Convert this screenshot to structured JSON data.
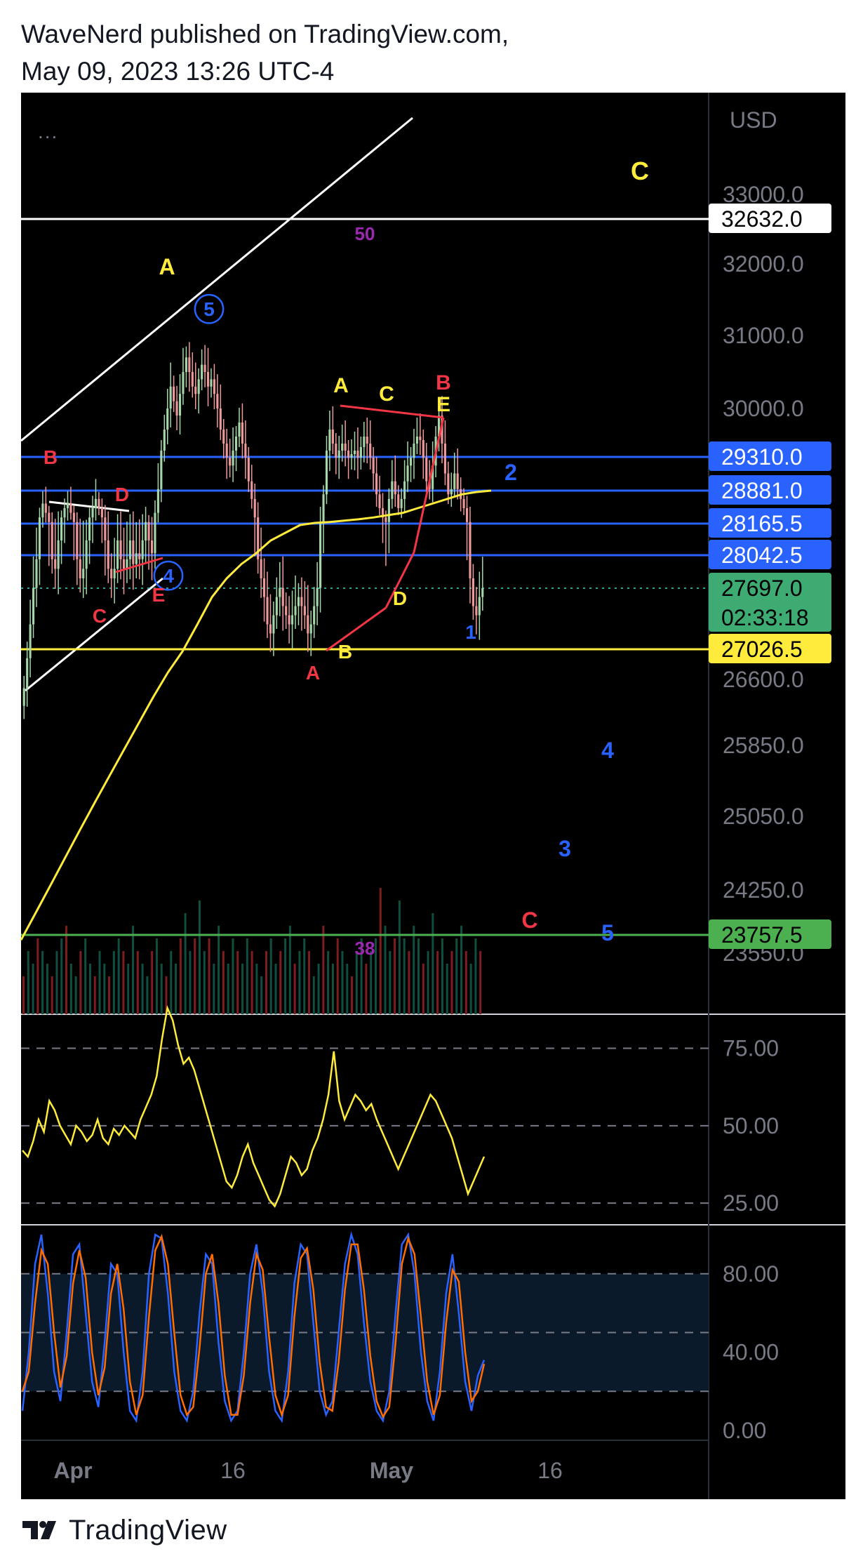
{
  "header": {
    "line1": "WaveNerd published on TradingView.com,",
    "line2": "May 09, 2023 13:26 UTC-4"
  },
  "footer": {
    "brand": "TradingView",
    "logo_icon": "tradingview-logo-icon"
  },
  "more_menu": "...",
  "colors": {
    "background": "#000000",
    "axis_text": "#787b86",
    "blue": "#2962ff",
    "yellow": "#ffeb3b",
    "red": "#f23645",
    "green": "#4caf50",
    "white": "#ffffff",
    "purple": "#9c27b0",
    "orange": "#ff6d00"
  },
  "chart_data": [
    {
      "type": "candlestick",
      "title": "",
      "currency": "USD",
      "x_ticks": [
        "Apr",
        "16",
        "May",
        "16"
      ],
      "y_ticks": [
        33000.0,
        32000.0,
        31000.0,
        30000.0,
        26600.0,
        25850.0,
        25050.0,
        24250.0,
        23550.0
      ],
      "y_tick_labels": [
        "33000.0",
        "32000.0",
        "31000.0",
        "30000.0",
        "26600.0",
        "25850.0",
        "25050.0",
        "24250.0",
        "23550.0"
      ],
      "price_tags": [
        {
          "value": "32632.0",
          "style": "white"
        },
        {
          "value": "29310.0",
          "style": "blue"
        },
        {
          "value": "28881.0",
          "style": "blue"
        },
        {
          "value": "28165.5",
          "style": "blue"
        },
        {
          "value": "28042.5",
          "style": "blue"
        },
        {
          "value": "27697.0",
          "style": "green",
          "countdown": "02:33:18"
        },
        {
          "value": "27026.5",
          "style": "yellow"
        },
        {
          "value": "23757.5",
          "style": "green"
        }
      ],
      "horizontal_levels": [
        {
          "value": 32632.0,
          "color": "white"
        },
        {
          "value": 29310.0,
          "color": "blue"
        },
        {
          "value": 28881.0,
          "color": "blue"
        },
        {
          "value": 28165.5,
          "color": "blue"
        },
        {
          "value": 28042.5,
          "color": "blue"
        },
        {
          "value": 27026.5,
          "color": "yellow"
        },
        {
          "value": 23757.5,
          "color": "green"
        }
      ],
      "last_price": 27697.0,
      "wave_labels": [
        {
          "text": "C",
          "color": "yellow"
        },
        {
          "text": "50",
          "color": "purple"
        },
        {
          "text": "A",
          "color": "yellow"
        },
        {
          "text": "5",
          "color": "blue",
          "circled": true
        },
        {
          "text": "A",
          "color": "yellow"
        },
        {
          "text": "C",
          "color": "yellow"
        },
        {
          "text": "B",
          "color": "red"
        },
        {
          "text": "E",
          "color": "yellow"
        },
        {
          "text": "B",
          "color": "red"
        },
        {
          "text": "D",
          "color": "red"
        },
        {
          "text": "2",
          "color": "blue"
        },
        {
          "text": "4",
          "color": "blue",
          "circled": true
        },
        {
          "text": "E",
          "color": "red"
        },
        {
          "text": "C",
          "color": "red"
        },
        {
          "text": "D",
          "color": "yellow"
        },
        {
          "text": "1",
          "color": "blue"
        },
        {
          "text": "B",
          "color": "yellow"
        },
        {
          "text": "A",
          "color": "red"
        },
        {
          "text": "4",
          "color": "blue"
        },
        {
          "text": "3",
          "color": "blue"
        },
        {
          "text": "C",
          "color": "red"
        },
        {
          "text": "5",
          "color": "blue"
        },
        {
          "text": "38",
          "color": "purple"
        }
      ],
      "candles_close": [
        26500,
        26900,
        27300,
        27700,
        28000,
        28300,
        28600,
        28400,
        28200,
        28000,
        27900,
        28100,
        28300,
        28500,
        28600,
        28400,
        28200,
        28000,
        27800,
        27900,
        28100,
        28300,
        28500,
        28700,
        28500,
        28300,
        28100,
        27900,
        27800,
        27900,
        28100,
        28000,
        27900,
        28000,
        28100,
        27950,
        28050,
        28000,
        28100,
        28200,
        28100,
        28050,
        28400,
        28900,
        29400,
        29700,
        30000,
        30300,
        30100,
        29900,
        30200,
        30500,
        30700,
        30500,
        30300,
        30200,
        30400,
        30600,
        30500,
        30300,
        30400,
        30200,
        30000,
        29700,
        29500,
        29300,
        29200,
        29400,
        29600,
        29800,
        29500,
        29300,
        29000,
        28700,
        28300,
        28000,
        27800,
        27600,
        27300,
        27200,
        27400,
        27600,
        27700,
        27500,
        27400,
        27300,
        27400,
        27500,
        27600,
        27500,
        27400,
        27200,
        27300,
        27500,
        27700,
        28200,
        28800,
        29400,
        29700,
        29500,
        29300,
        29400,
        29500,
        29400,
        29300,
        29350,
        29400,
        29300,
        29450,
        29600,
        29500,
        29300,
        29100,
        28800,
        28500,
        28300,
        28200,
        28700,
        29000,
        28800,
        28500,
        28700,
        29000,
        29200,
        29300,
        29500,
        29600,
        29550,
        29300,
        29000,
        28900,
        29200,
        29600,
        29900,
        29500,
        29100,
        28800,
        28900,
        29100,
        28900,
        28700,
        28500,
        28200,
        27800,
        27500,
        27400,
        27600,
        27697
      ],
      "moving_average": [
        23700,
        24000,
        24300,
        24600,
        24900,
        25200,
        25500,
        25800,
        26100,
        26400,
        26700,
        27000,
        27300,
        27600,
        27800,
        27950,
        28050,
        28100,
        28130,
        28160,
        28180,
        28200,
        28230,
        28260,
        28300,
        28350,
        28400,
        28500,
        28600,
        28700,
        28800,
        28850,
        28881
      ],
      "volume_relative": [
        0.3,
        0.5,
        0.4,
        0.6,
        0.5,
        0.4,
        0.3,
        0.5,
        0.6,
        0.7,
        0.4,
        0.3,
        0.5,
        0.6,
        0.4,
        0.3,
        0.5,
        0.4,
        0.3,
        0.5,
        0.6,
        0.5,
        0.4,
        0.7,
        0.5,
        0.4,
        0.3,
        0.5,
        0.6,
        0.4,
        0.3,
        0.5,
        0.4,
        0.6,
        0.8,
        0.5,
        0.6,
        0.9,
        0.5,
        0.6,
        0.4,
        0.7,
        0.5,
        0.4,
        0.6,
        0.5,
        0.4,
        0.6,
        0.5,
        0.4,
        0.3,
        0.5,
        0.6,
        0.4,
        0.5,
        0.6,
        0.7,
        0.4,
        0.5,
        0.6,
        0.5,
        0.3,
        0.4,
        0.7,
        0.5,
        0.4,
        0.6,
        0.5,
        0.4,
        0.3,
        0.5,
        0.6,
        0.4,
        0.5,
        0.6,
        1.0,
        0.7,
        0.5,
        0.6,
        0.9,
        0.6,
        0.5,
        0.7,
        0.6,
        0.4,
        0.5,
        0.8,
        0.5,
        0.6,
        0.4,
        0.5,
        0.6,
        0.7,
        0.5,
        0.4,
        0.6,
        0.5
      ]
    },
    {
      "type": "line",
      "title": "",
      "y_ticks": [
        75.0,
        50.0,
        25.0
      ],
      "y_tick_labels": [
        "75.00",
        "50.00",
        "25.00"
      ],
      "ylim": [
        18,
        86
      ],
      "series": [
        {
          "color": "yellow",
          "values": [
            42,
            40,
            45,
            52,
            48,
            58,
            55,
            50,
            47,
            44,
            50,
            48,
            45,
            47,
            52,
            46,
            44,
            49,
            47,
            50,
            48,
            46,
            52,
            56,
            60,
            66,
            78,
            88,
            84,
            76,
            70,
            72,
            68,
            62,
            56,
            50,
            44,
            38,
            32,
            30,
            34,
            40,
            44,
            38,
            34,
            30,
            26,
            24,
            28,
            34,
            40,
            38,
            34,
            36,
            42,
            46,
            52,
            60,
            74,
            58,
            52,
            56,
            60,
            58,
            55,
            57,
            52,
            48,
            44,
            40,
            36,
            40,
            44,
            48,
            52,
            56,
            60,
            58,
            54,
            50,
            46,
            40,
            34,
            28,
            32,
            36,
            40
          ]
        }
      ]
    },
    {
      "type": "line",
      "title": "",
      "y_ticks": [
        80.0,
        40.0,
        0.0
      ],
      "y_tick_labels": [
        "80.00",
        "40.00",
        "0.00"
      ],
      "ylim": [
        -5,
        105
      ],
      "series": [
        {
          "color": "blue",
          "values": [
            10,
            40,
            85,
            100,
            70,
            30,
            15,
            50,
            90,
            95,
            60,
            25,
            12,
            45,
            85,
            80,
            40,
            10,
            5,
            30,
            80,
            100,
            98,
            70,
            30,
            10,
            5,
            20,
            60,
            90,
            85,
            45,
            15,
            5,
            10,
            40,
            80,
            95,
            70,
            30,
            10,
            5,
            30,
            75,
            95,
            90,
            55,
            20,
            8,
            15,
            50,
            85,
            100,
            90,
            55,
            25,
            10,
            5,
            20,
            60,
            95,
            100,
            80,
            40,
            15,
            5,
            30,
            70,
            90,
            60,
            25,
            10,
            28,
            36
          ]
        },
        {
          "color": "orange",
          "values": [
            20,
            30,
            65,
            92,
            85,
            50,
            22,
            38,
            75,
            92,
            78,
            40,
            18,
            32,
            70,
            85,
            62,
            25,
            8,
            18,
            58,
            92,
            99,
            85,
            50,
            18,
            8,
            12,
            42,
            80,
            90,
            65,
            28,
            8,
            8,
            28,
            65,
            90,
            82,
            48,
            18,
            8,
            18,
            58,
            88,
            93,
            72,
            35,
            12,
            10,
            35,
            72,
            95,
            95,
            72,
            38,
            15,
            7,
            12,
            45,
            85,
            98,
            90,
            58,
            25,
            8,
            18,
            55,
            82,
            76,
            40,
            15,
            20,
            34
          ]
        }
      ]
    }
  ]
}
